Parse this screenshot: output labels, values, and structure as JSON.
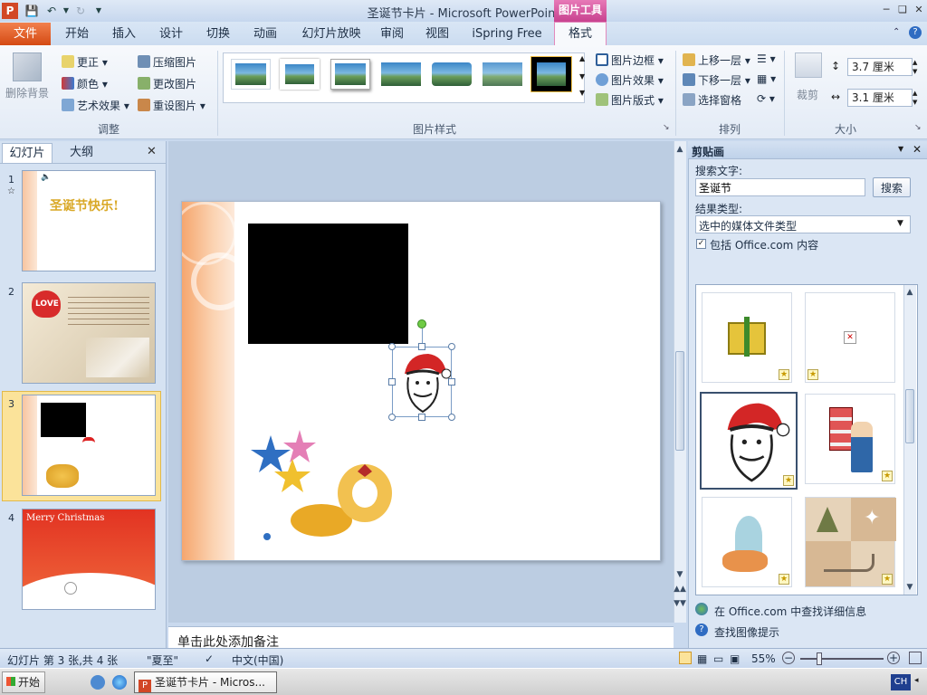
{
  "app": {
    "title": "圣诞节卡片 - Microsoft PowerPoint",
    "contextual_tab_group": "图片工具"
  },
  "tabs": [
    "文件",
    "开始",
    "插入",
    "设计",
    "切换",
    "动画",
    "幻灯片放映",
    "审阅",
    "视图",
    "iSpring Free",
    "格式"
  ],
  "ribbon": {
    "remove_bg": "删除背景",
    "adjust": {
      "corrections": "更正",
      "color": "颜色",
      "artistic": "艺术效果",
      "compress": "压缩图片",
      "change": "更改图片",
      "reset": "重设图片",
      "label": "调整"
    },
    "styles": {
      "border": "图片边框",
      "effects": "图片效果",
      "layout": "图片版式",
      "label": "图片样式"
    },
    "arrange": {
      "bring_forward": "上移一层",
      "send_backward": "下移一层",
      "selection_pane": "选择窗格",
      "label": "排列"
    },
    "size": {
      "crop": "裁剪",
      "height": "3.7 厘米",
      "width": "3.1 厘米",
      "label": "大小"
    }
  },
  "panel_tabs": {
    "slides": "幻灯片",
    "outline": "大纲"
  },
  "thumbnails": [
    {
      "num": "1",
      "text": "圣诞节快乐!"
    },
    {
      "num": "2",
      "text": "LOVE"
    },
    {
      "num": "3",
      "text": ""
    },
    {
      "num": "4",
      "text": "Merry Christmas"
    }
  ],
  "notes_placeholder": "单击此处添加备注",
  "clipart": {
    "title": "剪贴画",
    "search_label": "搜索文字:",
    "search_value": "圣诞节",
    "search_button": "搜索",
    "result_type_label": "结果类型:",
    "result_type_value": "选中的媒体文件类型",
    "include_office": "包括 Office.com 内容",
    "link_more": "在 Office.com 中查找详细信息",
    "link_tips": "查找图像提示"
  },
  "status": {
    "slide_info": "幻灯片 第 3 张,共 4 张",
    "theme": "\"夏至\"",
    "language": "中文(中国)",
    "zoom": "55%"
  },
  "taskbar": {
    "start": "开始",
    "task": "圣诞节卡片 - Micros...",
    "ime": "CH"
  },
  "colors": {
    "file_tab": "#d44a13",
    "contextual": "#c8428f",
    "accent": "#2b579a"
  }
}
